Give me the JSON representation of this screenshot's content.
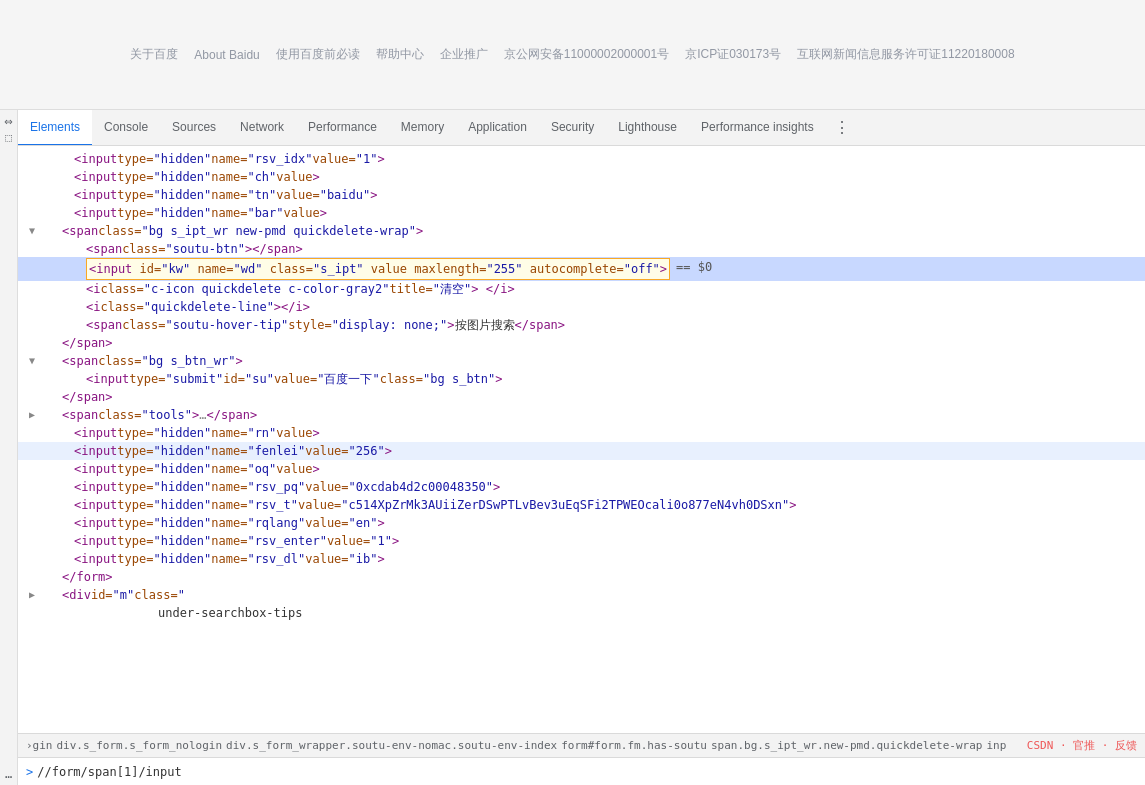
{
  "page": {
    "footer_links": [
      "关于百度",
      "About Baidu",
      "使用百度前必读",
      "帮助中心",
      "企业推广",
      "京公网安备11000002000001号",
      "京ICP证030173号",
      "互联网新闻信息服务许可证11220180008"
    ]
  },
  "devtools": {
    "tabs": [
      {
        "id": "elements",
        "label": "Elements",
        "active": true
      },
      {
        "id": "console",
        "label": "Console",
        "active": false
      },
      {
        "id": "sources",
        "label": "Sources",
        "active": false
      },
      {
        "id": "network",
        "label": "Network",
        "active": false
      },
      {
        "id": "performance",
        "label": "Performance",
        "active": false
      },
      {
        "id": "memory",
        "label": "Memory",
        "active": false
      },
      {
        "id": "application",
        "label": "Application",
        "active": false
      },
      {
        "id": "security",
        "label": "Security",
        "active": false
      },
      {
        "id": "lighthouse",
        "label": "Lighthouse",
        "active": false
      },
      {
        "id": "performance-insights",
        "label": "Performance insights",
        "active": false
      }
    ],
    "more_label": "⋮"
  },
  "code": {
    "lines": [
      {
        "id": 1,
        "indent": 3,
        "arrow": "empty",
        "html": "<input type=\"hidden\" name=\"rsv_idx\" value=\"1\">"
      },
      {
        "id": 2,
        "indent": 3,
        "arrow": "empty",
        "html": "<input type=\"hidden\" name=\"ch\" value>"
      },
      {
        "id": 3,
        "indent": 3,
        "arrow": "empty",
        "html": "<input type=\"hidden\" name=\"tn\" value=\"baidu\">"
      },
      {
        "id": 4,
        "indent": 3,
        "arrow": "empty",
        "html": "<input type=\"hidden\" name=\"bar\" value>"
      },
      {
        "id": 5,
        "indent": 2,
        "arrow": "expanded",
        "html": "<span class=\"bg s_ipt_wr new-pmd quickdelete-wrap\">"
      },
      {
        "id": 6,
        "indent": 3,
        "arrow": "empty",
        "html": "<span class=\"soutu-btn\"></span>"
      },
      {
        "id": 7,
        "indent": 3,
        "arrow": "empty",
        "html": "<input id=\"kw\" name=\"wd\" class=\"s_ipt\" value maxlength=\"255\" autocomplete=\"off\"> == $0",
        "selected": true
      },
      {
        "id": 8,
        "indent": 3,
        "arrow": "empty",
        "html": "<i class=\"c-icon quickdelete c-color-gray2\" title=\"清空\">  </i>"
      },
      {
        "id": 9,
        "indent": 3,
        "arrow": "empty",
        "html": "<i class=\"quickdelete-line\"></i>"
      },
      {
        "id": 10,
        "indent": 3,
        "arrow": "empty",
        "html": "<span class=\"soutu-hover-tip\" style=\"display: none;\">按图片搜索</span>"
      },
      {
        "id": 11,
        "indent": 2,
        "arrow": "empty",
        "html": "</span>"
      },
      {
        "id": 12,
        "indent": 2,
        "arrow": "expanded",
        "html": "<span class=\"bg s_btn_wr\">"
      },
      {
        "id": 13,
        "indent": 3,
        "arrow": "empty",
        "html": "<input type=\"submit\" id=\"su\" value=\"百度一下\" class=\"bg s_btn\">"
      },
      {
        "id": 14,
        "indent": 2,
        "arrow": "empty",
        "html": "</span>"
      },
      {
        "id": 15,
        "indent": 2,
        "arrow": "collapsed",
        "html": "<span class=\"tools\"> … </span>"
      },
      {
        "id": 16,
        "indent": 3,
        "arrow": "empty",
        "html": "<input type=\"hidden\" name=\"rn\" value>"
      },
      {
        "id": 17,
        "indent": 3,
        "arrow": "empty",
        "html": "<input type=\"hidden\" name=\"fenlei\" value=\"256\">"
      },
      {
        "id": 18,
        "indent": 3,
        "arrow": "empty",
        "html": "<input type=\"hidden\" name=\"oq\" value>"
      },
      {
        "id": 19,
        "indent": 3,
        "arrow": "empty",
        "html": "<input type=\"hidden\" name=\"rsv_pq\" value=\"0xcdab4d2c00048350\">"
      },
      {
        "id": 20,
        "indent": 3,
        "arrow": "empty",
        "html": "<input type=\"hidden\" name=\"rsv_t\" value=\"c514XpZrMk3AUiiZerDSwPTLvBev3uEqSFi2TPWEOcali0o877eN4vh0DSxn\">"
      },
      {
        "id": 21,
        "indent": 3,
        "arrow": "empty",
        "html": "<input type=\"hidden\" name=\"rqlang\" value=\"en\">"
      },
      {
        "id": 22,
        "indent": 3,
        "arrow": "empty",
        "html": "<input type=\"hidden\" name=\"rsv_enter\" value=\"1\">"
      },
      {
        "id": 23,
        "indent": 3,
        "arrow": "empty",
        "html": "<input type=\"hidden\" name=\"rsv_dl\" value=\"ib\">"
      },
      {
        "id": 24,
        "indent": 2,
        "arrow": "empty",
        "html": "</form>"
      },
      {
        "id": 25,
        "indent": 2,
        "arrow": "collapsed",
        "html": "<div id=\"m\" class=\""
      },
      {
        "id": 26,
        "indent": 4,
        "arrow": "empty",
        "html": "under-searchbox-tips"
      }
    ]
  },
  "status_bar": {
    "breadcrumbs": [
      {
        "id": "bc1",
        "label": "›gin"
      },
      {
        "id": "bc2",
        "label": "div.s_form.s_form_nologin"
      },
      {
        "id": "bc3",
        "label": "div.s_form_wrapper.soutu-env-nomac.soutu-env-index"
      },
      {
        "id": "bc4",
        "label": "form#form.fm.has-soutu"
      },
      {
        "id": "bc5",
        "label": "span.bg.s_ipt_wr.new-pmd.quickdelete-wrap"
      },
      {
        "id": "bc6",
        "label": "inp"
      }
    ],
    "right": {
      "text": "CSDN · 官推 · 反馈"
    },
    "console_path": "//form/span[1]/input"
  }
}
